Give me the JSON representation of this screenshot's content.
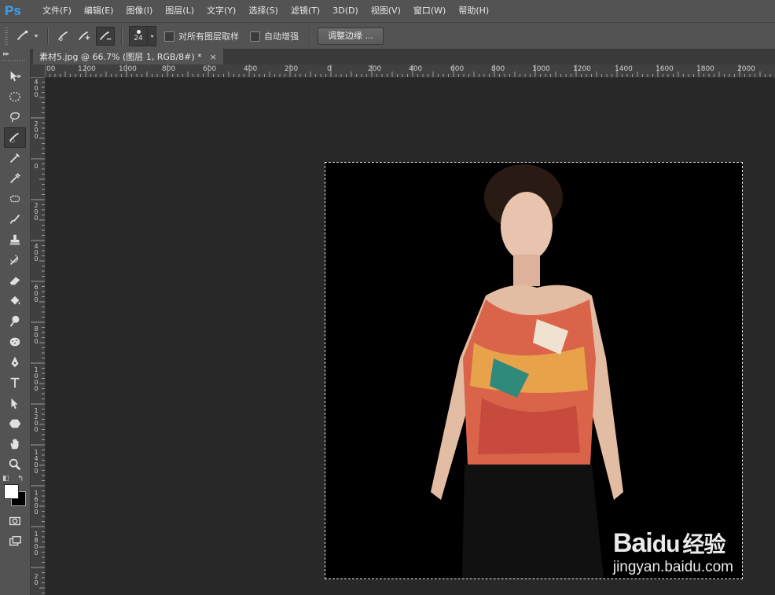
{
  "app": {
    "logo": "Ps"
  },
  "menu": [
    "文件(F)",
    "编辑(E)",
    "图像(I)",
    "图层(L)",
    "文字(Y)",
    "选择(S)",
    "滤镜(T)",
    "3D(D)",
    "视图(V)",
    "窗口(W)",
    "帮助(H)"
  ],
  "options": {
    "brush_size": "24",
    "sample_all_layers": "对所有图层取样",
    "auto_enhance": "自动增强",
    "refine_edge": "调整边缘 ..."
  },
  "document": {
    "tab_title": "素材5.jpg @ 66.7% (图层 1, RGB/8#) *",
    "close_glyph": "×"
  },
  "ruler_h": [
    "00",
    "1200",
    "1000",
    "800",
    "600",
    "400",
    "200",
    "0",
    "200",
    "400",
    "600",
    "800",
    "1000",
    "1200",
    "1400",
    "1600",
    "1800",
    "2000"
  ],
  "ruler_v": [
    "400",
    "200",
    "0",
    "200",
    "400",
    "600",
    "800",
    "1000",
    "1200",
    "1400",
    "1600",
    "1800",
    "20"
  ],
  "watermark": {
    "brand": "Bai",
    "brand2": "经验",
    "url": "jingyan.baidu.com"
  },
  "colors": {
    "foreground": "#ffffff",
    "background": "#000000",
    "ps_blue": "#36a4f4"
  }
}
